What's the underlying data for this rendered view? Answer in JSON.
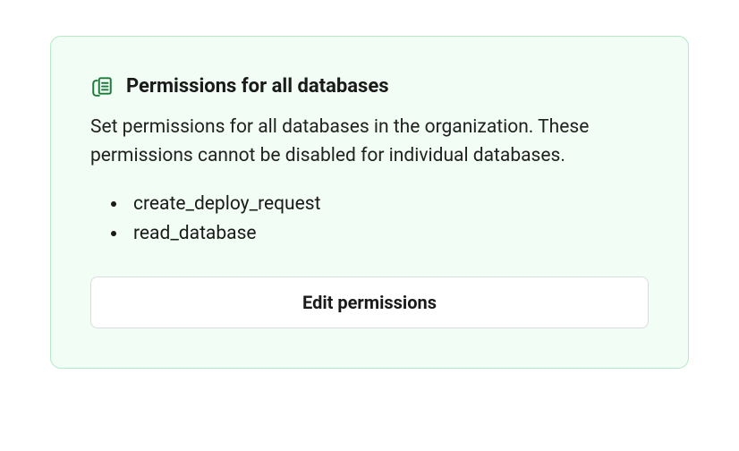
{
  "card": {
    "title": "Permissions for all databases",
    "description": "Set permissions for all databases in the organization. These permissions cannot be disabled for individual databases.",
    "permissions": [
      "create_deploy_request",
      "read_database"
    ],
    "button_label": "Edit permissions"
  }
}
